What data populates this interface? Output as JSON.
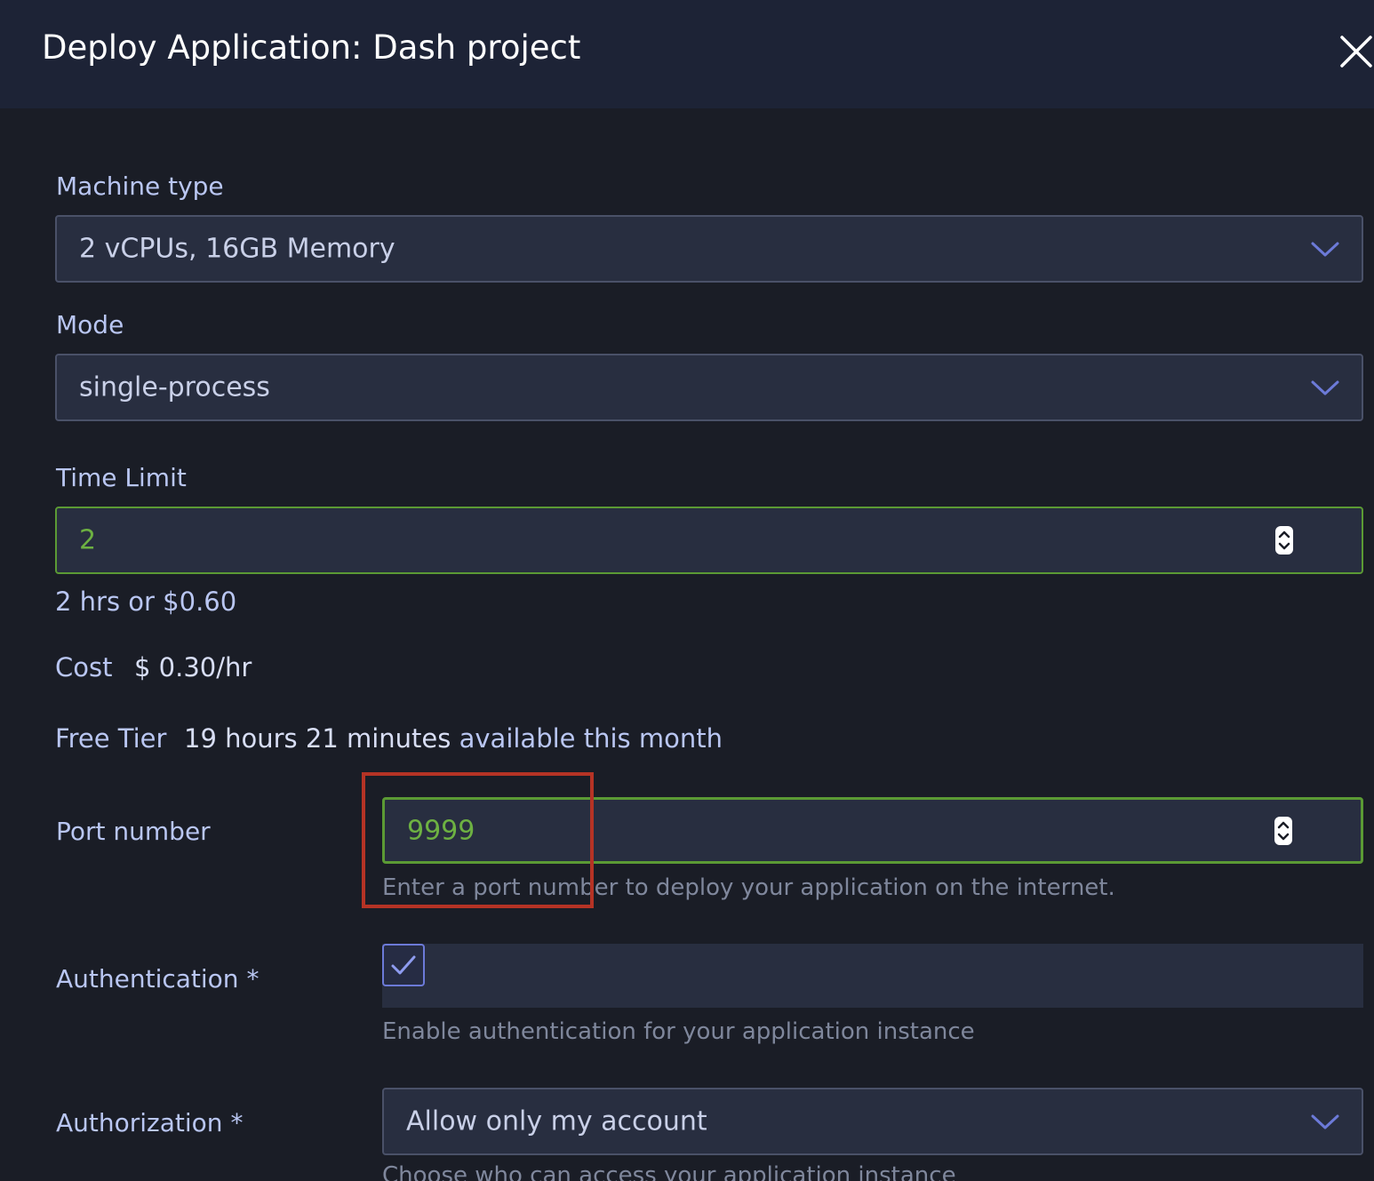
{
  "dialog": {
    "title": "Deploy Application: Dash project"
  },
  "machine_type": {
    "label": "Machine type",
    "value": "2 vCPUs, 16GB Memory"
  },
  "mode": {
    "label": "Mode",
    "value": "single-process"
  },
  "time_limit": {
    "label": "Time Limit",
    "value": "2",
    "summary": "2 hrs or $0.60"
  },
  "cost": {
    "label": "Cost",
    "value": "$ 0.30/hr"
  },
  "free_tier": {
    "label": "Free Tier",
    "amount": "19 hours 21 minutes",
    "suffix": "available this month"
  },
  "port": {
    "label": "Port number",
    "value": "9999",
    "helper": "Enter a port number to deploy your application on the internet."
  },
  "authentication": {
    "label": "Authentication *",
    "checked": true,
    "helper": "Enable authentication for your application instance"
  },
  "authorization": {
    "label": "Authorization *",
    "value": "Allow only my account",
    "helper": "Choose who can access your application instance"
  },
  "colors": {
    "header_bg": "#1d2336",
    "body_bg": "#1a1d26",
    "field_bg": "#282e40",
    "valid_border": "#5b9a34",
    "accent": "#6c7ad8",
    "highlight": "#b53325"
  }
}
